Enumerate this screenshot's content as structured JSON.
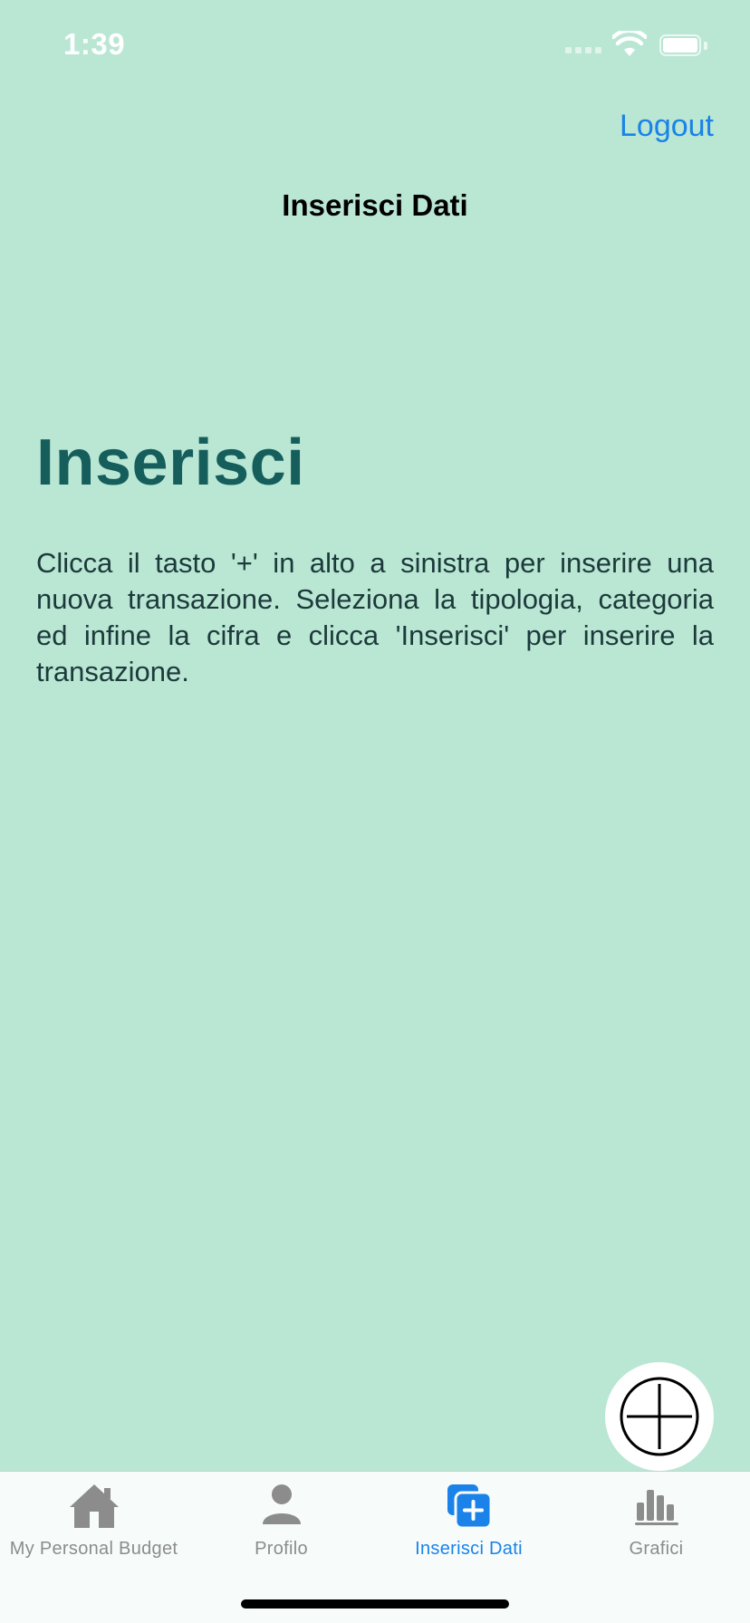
{
  "status_bar": {
    "time": "1:39"
  },
  "nav": {
    "logout_label": "Logout",
    "title": "Inserisci Dati"
  },
  "main": {
    "heading": "Inserisci",
    "instructions": "Clicca il tasto '+' in alto a sinistra per inserire una nuova transazione. Seleziona la tipologia, categoria ed infine la cifra e clicca 'Inserisci' per inserire la transazione."
  },
  "fab": {
    "icon": "plus-circle-icon"
  },
  "tabs": [
    {
      "label": "My Personal Budget",
      "icon": "house-icon",
      "active": false
    },
    {
      "label": "Profilo",
      "icon": "person-icon",
      "active": false
    },
    {
      "label": "Inserisci Dati",
      "icon": "plus-square-on-square-icon",
      "active": true
    },
    {
      "label": "Grafici",
      "icon": "chart-bar-icon",
      "active": false
    }
  ],
  "colors": {
    "background": "#bae6d4",
    "accent": "#1a82e8",
    "heading": "#155e5c",
    "tab_inactive": "#8c8c8c"
  }
}
